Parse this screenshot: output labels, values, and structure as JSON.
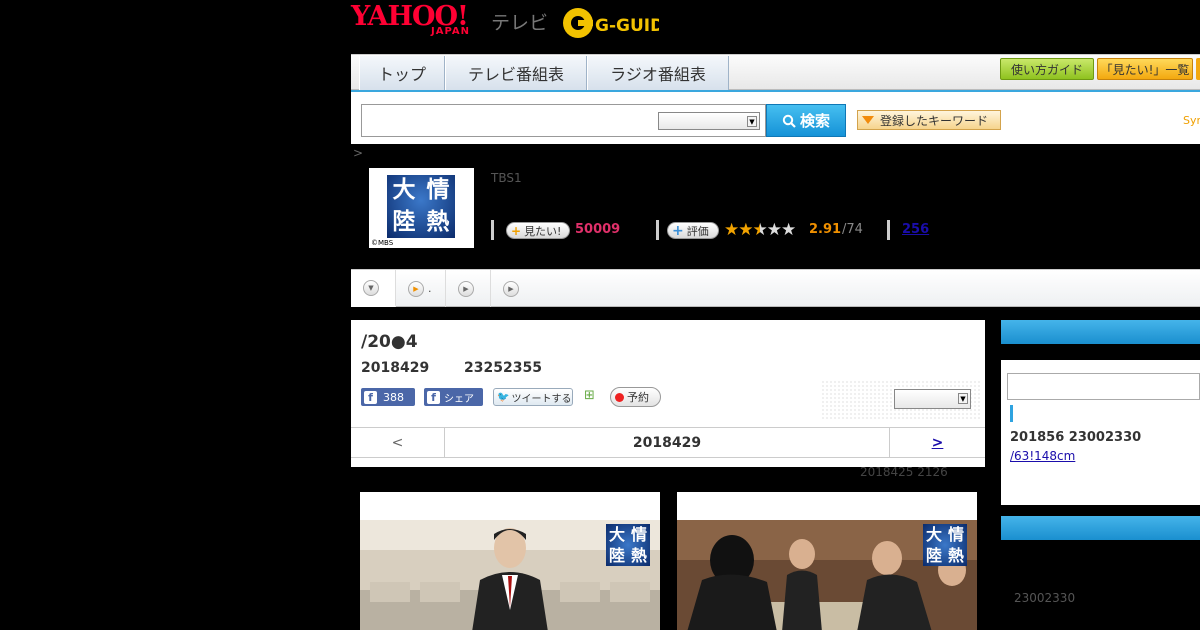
{
  "header": {
    "yahoo_logo": "YAHOO!",
    "yahoo_japan": "JAPAN",
    "tv_label": "テレビ",
    "gguide_label": "G-GUIDE"
  },
  "nav": {
    "tabs": [
      "トップ",
      "テレビ番組表",
      "ラジオ番組表"
    ],
    "guide_btn": "使い方ガイド",
    "mitai_btn": "「見たい!」一覧"
  },
  "search": {
    "placeholder": "",
    "button_label": "検索",
    "keyword_btn": "登録したキーワード",
    "syn_label": "Syn"
  },
  "breadcrumb_arrow": ">",
  "program": {
    "thumb_chars": [
      "情",
      "熱",
      "大",
      "陸"
    ],
    "thumb_copyright": "©MBS",
    "channel": "TBS1",
    "mitai_label": "見たい!",
    "mitai_count": "50009",
    "rating_label": "評価",
    "rating_value": "2.91",
    "rating_count": "/74",
    "comment_count": "256"
  },
  "subtabs": [
    ".",
    "",
    ""
  ],
  "episode": {
    "title": "/20●4",
    "date": "2018429",
    "time": "23252355",
    "like_count": "388",
    "share_label": "シェア",
    "tweet_label": "ツイートする",
    "reserve_label": "予約"
  },
  "pager": {
    "prev": "<",
    "date": "2018429",
    "next": ">"
  },
  "updated": "2018425  2126",
  "sidebar": {
    "line1": "201856  23002330",
    "link": "/63!148cm",
    "time2": "23002330"
  },
  "colors": {
    "accent_blue": "#1a8fcf",
    "yahoo_red": "#ff0033",
    "mitai_pink": "#e0306a",
    "rating_orange": "#f09000"
  }
}
